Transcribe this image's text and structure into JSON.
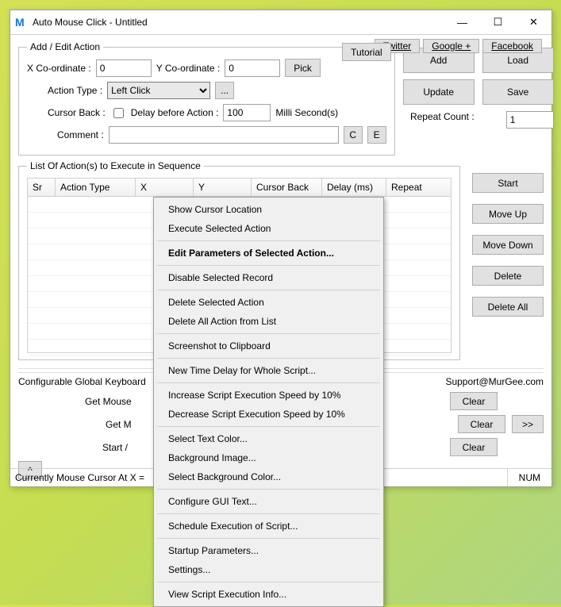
{
  "window": {
    "logo": "M",
    "title": "Auto Mouse Click - Untitled"
  },
  "toplinks": {
    "tutorial": "Tutorial",
    "twitter": "Twitter",
    "google": "Google +",
    "facebook": "Facebook"
  },
  "addedit": {
    "legend": "Add / Edit Action",
    "xlabel": "X Co-ordinate :",
    "xval": "0",
    "ylabel": "Y Co-ordinate :",
    "yval": "0",
    "pick": "Pick",
    "actiontype_label": "Action Type :",
    "actiontype_val": "Left Click",
    "dots": "...",
    "cursorback_label": "Cursor Back :",
    "delay_label": "Delay before Action :",
    "delay_val": "100",
    "ms_label": "Milli Second(s)",
    "comment_label": "Comment :",
    "comment_val": "",
    "c": "C",
    "e": "E",
    "repeat_label": "Repeat Count :",
    "repeat_val": "1"
  },
  "buttons": {
    "add": "Add",
    "load": "Load",
    "update": "Update",
    "save": "Save",
    "start": "Start",
    "moveup": "Move Up",
    "movedown": "Move Down",
    "delete": "Delete",
    "deleteall": "Delete All",
    "clear": "Clear",
    "more": ">>",
    "collapse": "^"
  },
  "list": {
    "legend": "List Of Action(s) to Execute in Sequence",
    "headers": {
      "sr": "Sr",
      "actiontype": "Action Type",
      "x": "X",
      "y": "Y",
      "cursorback": "Cursor Back",
      "delay": "Delay (ms)",
      "repeat": "Repeat"
    }
  },
  "bottom": {
    "cfg": "Configurable Global Keyboard",
    "getmouse": "Get Mouse",
    "getm": "Get M",
    "startstop": "Start / ",
    "support": "Support@MurGee.com"
  },
  "status": {
    "left": "Currently Mouse Cursor At X =",
    "right": "NUM"
  },
  "menu": [
    {
      "t": "item",
      "label": "Show Cursor Location"
    },
    {
      "t": "item",
      "label": "Execute Selected Action"
    },
    {
      "t": "sep"
    },
    {
      "t": "item",
      "label": "Edit Parameters of Selected Action...",
      "bold": true
    },
    {
      "t": "sep"
    },
    {
      "t": "item",
      "label": "Disable Selected Record"
    },
    {
      "t": "sep"
    },
    {
      "t": "item",
      "label": "Delete Selected Action"
    },
    {
      "t": "item",
      "label": "Delete All Action from List"
    },
    {
      "t": "sep"
    },
    {
      "t": "item",
      "label": "Screenshot to Clipboard"
    },
    {
      "t": "sep"
    },
    {
      "t": "item",
      "label": "New Time Delay for Whole Script..."
    },
    {
      "t": "sep"
    },
    {
      "t": "item",
      "label": "Increase Script Execution Speed by 10%"
    },
    {
      "t": "item",
      "label": "Decrease Script Execution Speed by 10%"
    },
    {
      "t": "sep"
    },
    {
      "t": "item",
      "label": "Select Text Color..."
    },
    {
      "t": "item",
      "label": "Background Image..."
    },
    {
      "t": "item",
      "label": "Select Background Color..."
    },
    {
      "t": "sep"
    },
    {
      "t": "item",
      "label": "Configure GUI Text..."
    },
    {
      "t": "sep"
    },
    {
      "t": "item",
      "label": "Schedule Execution of Script..."
    },
    {
      "t": "sep"
    },
    {
      "t": "item",
      "label": "Startup Parameters..."
    },
    {
      "t": "item",
      "label": "Settings..."
    },
    {
      "t": "sep"
    },
    {
      "t": "item",
      "label": "View Script Execution Info..."
    }
  ]
}
